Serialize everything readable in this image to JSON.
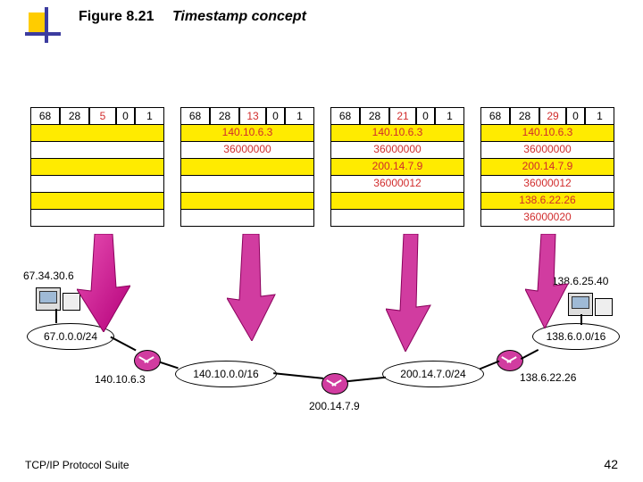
{
  "figure": {
    "label": "Figure 8.21",
    "title": "Timestamp concept"
  },
  "packets": [
    {
      "header": [
        "68",
        "28",
        "5",
        "0",
        "1"
      ],
      "rows": [
        {
          "text": "",
          "color": "yellow"
        },
        {
          "text": "",
          "color": "white"
        },
        {
          "text": "",
          "color": "yellow"
        },
        {
          "text": "",
          "color": "white"
        },
        {
          "text": "",
          "color": "yellow"
        },
        {
          "text": "",
          "color": "white"
        }
      ]
    },
    {
      "header": [
        "68",
        "28",
        "13",
        "0",
        "1"
      ],
      "rows": [
        {
          "text": "140.10.6.3",
          "color": "yellow",
          "red": true
        },
        {
          "text": "36000000",
          "color": "white",
          "red": true
        },
        {
          "text": "",
          "color": "yellow"
        },
        {
          "text": "",
          "color": "white"
        },
        {
          "text": "",
          "color": "yellow"
        },
        {
          "text": "",
          "color": "white"
        }
      ]
    },
    {
      "header": [
        "68",
        "28",
        "21",
        "0",
        "1"
      ],
      "rows": [
        {
          "text": "140.10.6.3",
          "color": "yellow",
          "red": true
        },
        {
          "text": "36000000",
          "color": "white",
          "red": true
        },
        {
          "text": "200.14.7.9",
          "color": "yellow",
          "red": true
        },
        {
          "text": "36000012",
          "color": "white",
          "red": true
        },
        {
          "text": "",
          "color": "yellow"
        },
        {
          "text": "",
          "color": "white"
        }
      ]
    },
    {
      "header": [
        "68",
        "28",
        "29",
        "0",
        "1"
      ],
      "rows": [
        {
          "text": "140.10.6.3",
          "color": "yellow",
          "red": true
        },
        {
          "text": "36000000",
          "color": "white",
          "red": true
        },
        {
          "text": "200.14.7.9",
          "color": "yellow",
          "red": true
        },
        {
          "text": "36000012",
          "color": "white",
          "red": true
        },
        {
          "text": "138.6.22.26",
          "color": "yellow",
          "red": true
        },
        {
          "text": "36000020",
          "color": "white",
          "red": true
        }
      ]
    }
  ],
  "nodes": {
    "net1": "67.0.0.0/24",
    "net2": "140.10.0.0/16",
    "net3": "200.14.7.0/24",
    "net4": "138.6.0.0/16",
    "hostA": "67.34.30.6",
    "hostB": "138.6.25.40",
    "r1": "140.10.6.3",
    "r2": "200.14.7.9",
    "r3": "138.6.22.26"
  },
  "footer": "TCP/IP Protocol Suite",
  "page": "42"
}
